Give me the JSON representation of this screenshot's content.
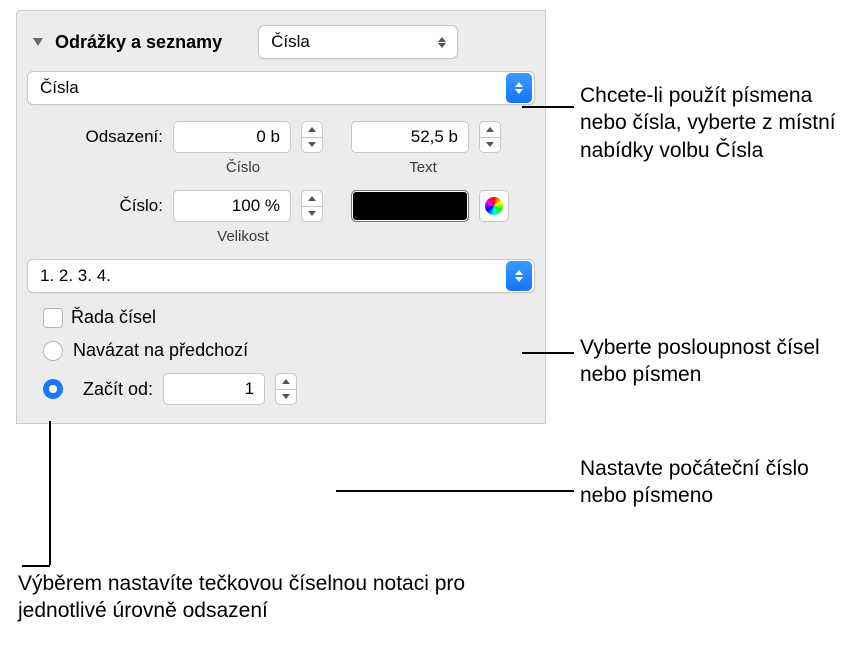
{
  "section": {
    "title": "Odrážky a seznamy"
  },
  "top_popup": {
    "value": "Čísla"
  },
  "style_popup": {
    "value": "Čísla"
  },
  "indent": {
    "label": "Odsazení:",
    "number_value": "0 b",
    "number_sublabel": "Číslo",
    "text_value": "52,5 b",
    "text_sublabel": "Text"
  },
  "number": {
    "label": "Číslo:",
    "size_value": "100 %",
    "size_sublabel": "Velikost"
  },
  "sequence_popup": {
    "value": "1. 2. 3. 4."
  },
  "tiered_checkbox": {
    "label": "Řada čísel"
  },
  "continue_radio": {
    "label": "Navázat na předchozí"
  },
  "start_radio": {
    "label": "Začít od:",
    "value": "1"
  },
  "callouts": {
    "style": "Chcete-li použít písmena nebo čísla, vyberte z místní nabídky volbu Čísla",
    "sequence": "Vyberte posloupnost čísel nebo písmen",
    "start": "Nastavte počáteční číslo nebo písmeno",
    "tiered": "Výběrem nastavíte tečkovou číselnou notaci pro jednotlivé úrovně odsazení"
  }
}
